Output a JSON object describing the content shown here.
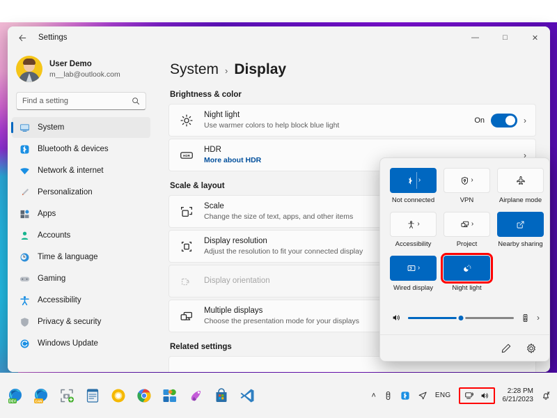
{
  "window": {
    "title": "Settings",
    "back_icon": "back-arrow-icon",
    "minimize": "—",
    "maximize": "□",
    "close": "✕"
  },
  "sidebar": {
    "account": {
      "name": "User Demo",
      "email": "m__lab@outlook.com",
      "avatar_icon": "user-avatar"
    },
    "search": {
      "placeholder": "Find a setting",
      "value": "",
      "icon": "search-icon"
    },
    "items": [
      {
        "label": "System",
        "icon": "monitor-icon",
        "selected": true
      },
      {
        "label": "Bluetooth & devices",
        "icon": "bluetooth-icon",
        "selected": false
      },
      {
        "label": "Network & internet",
        "icon": "wifi-icon",
        "selected": false
      },
      {
        "label": "Personalization",
        "icon": "paintbrush-icon",
        "selected": false
      },
      {
        "label": "Apps",
        "icon": "apps-grid-icon",
        "selected": false
      },
      {
        "label": "Accounts",
        "icon": "person-icon",
        "selected": false
      },
      {
        "label": "Time & language",
        "icon": "clock-globe-icon",
        "selected": false
      },
      {
        "label": "Gaming",
        "icon": "gamepad-icon",
        "selected": false
      },
      {
        "label": "Accessibility",
        "icon": "accessibility-person-icon",
        "selected": false
      },
      {
        "label": "Privacy & security",
        "icon": "shield-icon",
        "selected": false
      },
      {
        "label": "Windows Update",
        "icon": "update-refresh-icon",
        "selected": false
      }
    ]
  },
  "content": {
    "breadcrumb": {
      "parent": "System",
      "separator": "›",
      "current": "Display"
    },
    "sections": [
      {
        "title": "Brightness & color",
        "rows": [
          {
            "title": "Night light",
            "subtitle": "Use warmer colors to help block blue light",
            "icon": "sun-brightness-icon",
            "toggle_label": "On",
            "toggle_state": "on",
            "chevron": "›"
          },
          {
            "title": "HDR",
            "link": "More about HDR",
            "icon": "hdr-badge-icon",
            "chevron": "›"
          }
        ]
      },
      {
        "title": "Scale & layout",
        "rows": [
          {
            "title": "Scale",
            "subtitle": "Change the size of text, apps, and other items",
            "icon": "scale-icon",
            "chevron": "›"
          },
          {
            "title": "Display resolution",
            "subtitle": "Adjust the resolution to fit your connected display",
            "icon": "resolution-icon",
            "chevron": "›"
          },
          {
            "title": "Display orientation",
            "subtitle": "",
            "icon": "orientation-icon",
            "disabled": true,
            "chevron": ""
          },
          {
            "title": "Multiple displays",
            "subtitle": "Choose the presentation mode for your displays",
            "icon": "multiple-displays-icon",
            "chevron": "›"
          }
        ]
      },
      {
        "title": "Related settings",
        "rows": []
      }
    ]
  },
  "quick_settings": {
    "tiles": [
      {
        "label": "Not connected",
        "icon": "bluetooth-icon",
        "state": "on",
        "has_expand": true,
        "highlight": false
      },
      {
        "label": "VPN",
        "icon": "vpn-shield-icon",
        "state": "off",
        "has_expand": true,
        "highlight": false
      },
      {
        "label": "Airplane mode",
        "icon": "airplane-icon",
        "state": "off",
        "has_expand": false,
        "highlight": false
      },
      {
        "label": "Accessibility",
        "icon": "accessibility-person-icon",
        "state": "off",
        "has_expand": true,
        "highlight": false
      },
      {
        "label": "Project",
        "icon": "project-screen-icon",
        "state": "off",
        "has_expand": true,
        "highlight": false
      },
      {
        "label": "Nearby sharing",
        "icon": "nearby-share-icon",
        "state": "on",
        "has_expand": false,
        "highlight": false
      },
      {
        "label": "Wired display",
        "icon": "wired-display-icon",
        "state": "on",
        "has_expand": true,
        "highlight": false
      },
      {
        "label": "Night light",
        "icon": "night-light-icon",
        "state": "on",
        "has_expand": false,
        "highlight": true
      }
    ],
    "volume": {
      "icon": "speaker-icon",
      "value": 50,
      "output_icon": "audio-output-icon",
      "chevron": "›"
    },
    "footer": {
      "edit_icon": "pencil-edit-icon",
      "settings_icon": "gear-icon"
    },
    "accent_color": "#0067c0",
    "highlight_color": "#ff0000"
  },
  "taskbar": {
    "apps": [
      {
        "name": "edge-dev-icon"
      },
      {
        "name": "edge-canary-icon"
      },
      {
        "name": "snipping-tool-icon"
      },
      {
        "name": "notepad-icon"
      },
      {
        "name": "chrome-canary-icon"
      },
      {
        "name": "chrome-icon"
      },
      {
        "name": "microsoft-store-tiles-icon"
      },
      {
        "name": "paint-cocreator-icon"
      },
      {
        "name": "store-bag-icon"
      },
      {
        "name": "vscode-icon"
      }
    ],
    "tray": {
      "overflow": "˄",
      "pen_icon": "pen-icon",
      "bluetooth_icon": "bluetooth-icon",
      "send-icon": "➤",
      "language": "ENG",
      "network_icon": "network-icon",
      "volume_icon": "volume-icon",
      "time": "2:28 PM",
      "date": "6/21/2023",
      "notification_icon": "notification-bell-icon"
    }
  }
}
